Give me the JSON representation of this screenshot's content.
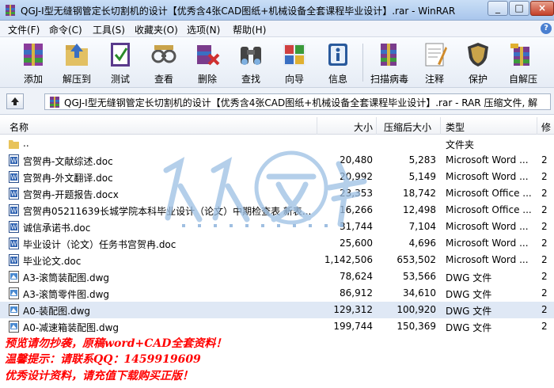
{
  "window": {
    "title": "QGJ-I型无缝钢管定长切割机的设计【优秀含4张CAD图纸+机械设备全套课程毕业设计】.rar - WinRAR",
    "minimize": "_",
    "maximize": "□",
    "close": "×"
  },
  "menu": [
    "文件(F)",
    "命令(C)",
    "工具(S)",
    "收藏夹(O)",
    "选项(N)",
    "帮助(H)"
  ],
  "toolbar": [
    {
      "label": "添加",
      "icon": "add-archive-icon"
    },
    {
      "label": "解压到",
      "icon": "extract-to-icon"
    },
    {
      "label": "测试",
      "icon": "test-icon"
    },
    {
      "label": "查看",
      "icon": "view-icon"
    },
    {
      "label": "删除",
      "icon": "delete-icon"
    },
    {
      "label": "查找",
      "icon": "find-icon"
    },
    {
      "label": "向导",
      "icon": "wizard-icon"
    },
    {
      "label": "信息",
      "icon": "info-icon"
    },
    {
      "label": "扫描病毒",
      "icon": "virus-scan-icon"
    },
    {
      "label": "注释",
      "icon": "comment-icon"
    },
    {
      "label": "保护",
      "icon": "protect-icon"
    },
    {
      "label": "自解压",
      "icon": "sfx-icon"
    }
  ],
  "address": {
    "path": "QGJ-I型无缝钢管定长切割机的设计【优秀含4张CAD图纸+机械设备全套课程毕业设计】.rar - RAR 压缩文件, 解"
  },
  "columns": {
    "name": "名称",
    "size": "大小",
    "packed": "压缩后大小",
    "type": "类型",
    "modified": "修"
  },
  "files": [
    {
      "name": "..",
      "size": "",
      "packed": "",
      "type": "文件夹",
      "mod": "",
      "kind": "folder"
    },
    {
      "name": "宫贺冉-文献综述.doc",
      "size": "20,480",
      "packed": "5,283",
      "type": "Microsoft Word ...",
      "mod": "2",
      "kind": "doc"
    },
    {
      "name": "宫贺冉-外文翻译.doc",
      "size": "20,992",
      "packed": "5,149",
      "type": "Microsoft Word ...",
      "mod": "2",
      "kind": "doc"
    },
    {
      "name": "宫贺冉-开题报告.docx",
      "size": "23,353",
      "packed": "18,742",
      "type": "Microsoft Office ...",
      "mod": "2",
      "kind": "doc"
    },
    {
      "name": "宫贺冉05211639长城学院本科毕业设计（论文）中期检查表  新表...",
      "size": "16,266",
      "packed": "12,498",
      "type": "Microsoft Office ...",
      "mod": "2",
      "kind": "doc"
    },
    {
      "name": "诚信承诺书.doc",
      "size": "31,744",
      "packed": "7,104",
      "type": "Microsoft Word ...",
      "mod": "2",
      "kind": "doc"
    },
    {
      "name": "毕业设计（论文）任务书宫贺冉.doc",
      "size": "25,600",
      "packed": "4,696",
      "type": "Microsoft Word ...",
      "mod": "2",
      "kind": "doc"
    },
    {
      "name": "毕业论文.doc",
      "size": "1,142,506",
      "packed": "653,502",
      "type": "Microsoft Word ...",
      "mod": "2",
      "kind": "doc"
    },
    {
      "name": "A3-滚筒装配图.dwg",
      "size": "78,624",
      "packed": "53,566",
      "type": "DWG 文件",
      "mod": "2",
      "kind": "dwg"
    },
    {
      "name": "A3-滚筒零件图.dwg",
      "size": "86,912",
      "packed": "34,610",
      "type": "DWG 文件",
      "mod": "2",
      "kind": "dwg"
    },
    {
      "name": "A0-装配图.dwg",
      "size": "129,312",
      "packed": "100,920",
      "type": "DWG 文件",
      "mod": "2",
      "kind": "dwg",
      "selected": true
    },
    {
      "name": "A0-减速箱装配图.dwg",
      "size": "199,744",
      "packed": "150,369",
      "type": "DWG 文件",
      "mod": "2",
      "kind": "dwg"
    }
  ],
  "watermark": {
    "chars": "人人文库",
    "url": "w w w . r e n r e n d o c . c o m"
  },
  "notes": [
    "预览请勿抄袭，原稿word+CAD全套资料！",
    "温馨提示：请联系QQ：1459919609",
    "优秀设计资料，请充值下载购买正版！"
  ],
  "colors": {
    "note_red": "#ff0000",
    "selection": "#dfe8f5",
    "title_gradient_top": "#c9def6",
    "watermark_blue": "#8fb4dc"
  }
}
